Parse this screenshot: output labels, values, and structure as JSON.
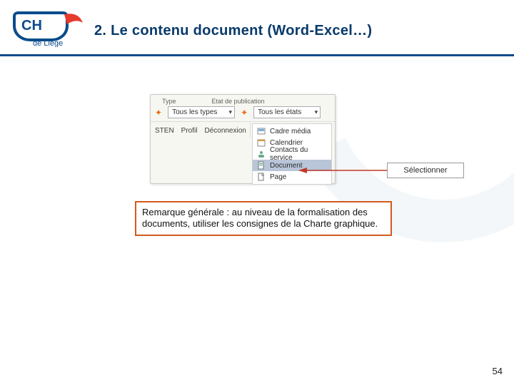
{
  "logo": {
    "top": "CH",
    "bottom": "de Liège"
  },
  "title": "2. Le contenu document (Word-Excel…)",
  "screenshot": {
    "label_type": "Type",
    "label_etat": "Etat de publication",
    "select_type": "Tous les types",
    "select_etat": "Tous les états",
    "strip": {
      "item1": "STEN",
      "item2": "Profil",
      "item3": "Déconnexion"
    },
    "menu": [
      {
        "label": "Cadre média",
        "hl": false
      },
      {
        "label": "Calendrier",
        "hl": false
      },
      {
        "label": "Contacts du service",
        "hl": false
      },
      {
        "label": "Document",
        "hl": true
      },
      {
        "label": "Page",
        "hl": false
      }
    ]
  },
  "callout": "Sélectionner",
  "remark": "Remarque générale : au niveau de la formalisation des documents, utiliser les consignes de la Charte graphique.",
  "page_number": "54",
  "colors": {
    "brand_blue": "#0b4c8b",
    "accent_orange": "#d25a1f"
  }
}
